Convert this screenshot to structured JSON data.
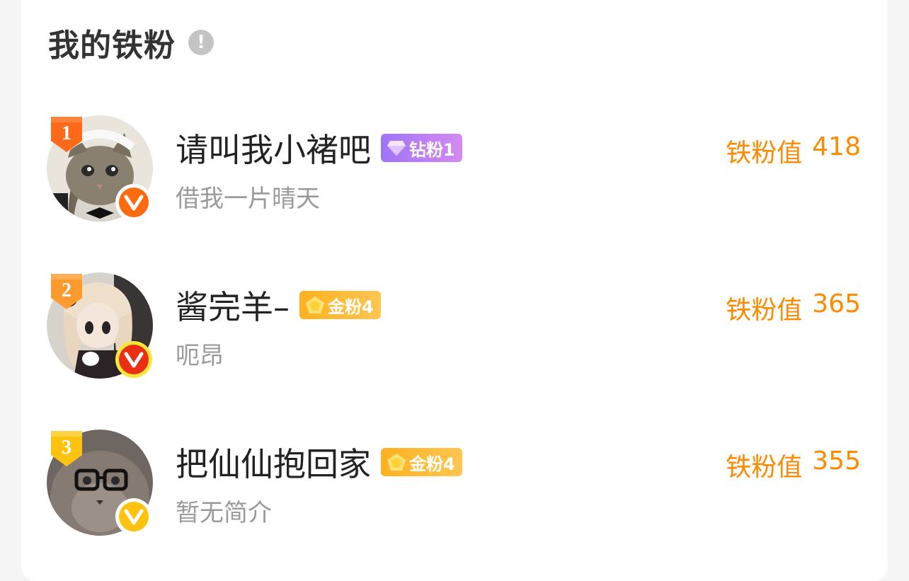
{
  "header": {
    "title": "我的铁粉"
  },
  "fans": [
    {
      "rank": "1",
      "name": "请叫我小褚吧",
      "badge_label": "钻粉1",
      "bio": "借我一片晴天",
      "score_label": "铁粉值",
      "score_value": "418"
    },
    {
      "rank": "2",
      "name": "酱完羊–",
      "badge_label": "金粉4",
      "bio": "呃昂",
      "score_label": "铁粉值",
      "score_value": "365"
    },
    {
      "rank": "3",
      "name": "把仙仙抱回家",
      "badge_label": "金粉4",
      "bio": "暂无简介",
      "score_label": "铁粉值",
      "score_value": "355"
    }
  ],
  "colors": {
    "accent_score": "#ff8a00",
    "diamond_badge": "#b672f2",
    "gold_badge": "#ffb22e",
    "rank1": "#ff6a1a",
    "rank2": "#ff9a2e",
    "rank3": "#ffc20e"
  },
  "icons": [
    "info-icon",
    "rank-medal-icon",
    "verified-v-icon",
    "diamond-icon",
    "gold-gem-icon"
  ]
}
